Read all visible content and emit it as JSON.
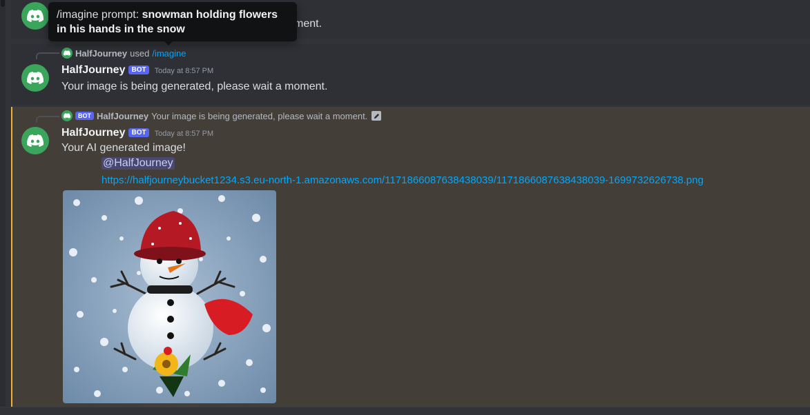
{
  "tooltip": {
    "prefix": "/imagine prompt:",
    "prompt": "snowman holding flowers in his hands in the snow"
  },
  "messages": {
    "first": {
      "partial_text": "ment."
    },
    "second": {
      "reply_user": "HalfJourney",
      "reply_action": "used",
      "reply_command": "/imagine",
      "username": "HalfJourney",
      "bot_badge": "BOT",
      "timestamp": "Today at 8:57 PM",
      "text": "Your image is being generated, please wait a moment."
    },
    "third": {
      "reply_badge": "BOT",
      "reply_user": "HalfJourney",
      "reply_text": "Your image is being generated, please wait a moment.",
      "username": "HalfJourney",
      "bot_badge": "BOT",
      "timestamp": "Today at 8:57 PM",
      "text": "Your AI generated image!",
      "mention": "@HalfJourney",
      "link": "https://halfjourneybucket1234.s3.eu-north-1.amazonaws.com/1171866087638438039/1171866087638438039-1699732626738.png",
      "image_alt": "snowman holding flowers in the snow"
    }
  },
  "colors": {
    "background": "#313338",
    "highlight_bg": "#433e38",
    "highlight_border": "#f0b232",
    "avatar": "#3ba55c",
    "bot_badge": "#5865f2",
    "link": "#00a8fc"
  },
  "icons": {
    "avatar": "discord-logo-icon",
    "edit": "edit-pencil-icon"
  }
}
